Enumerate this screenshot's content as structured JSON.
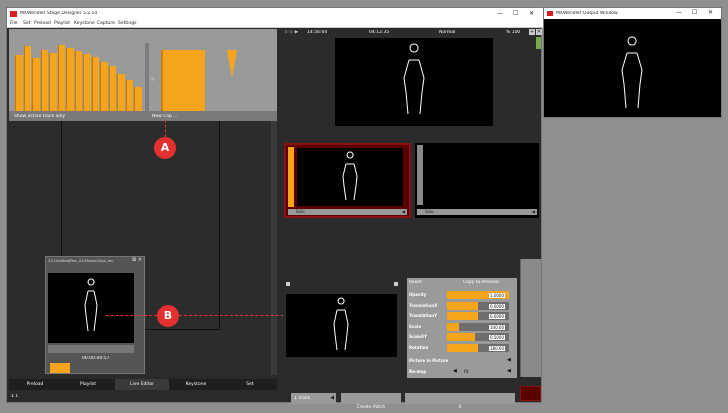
{
  "app": {
    "title": "MXWendler Stage Designer 5.2.14",
    "menu": [
      "File",
      "Set",
      "Preload",
      "Playlist",
      "Keystone",
      "Capture",
      "Settings"
    ]
  },
  "output_window": {
    "title": "MXWendler Output Window"
  },
  "clip_panel": {
    "show_active_label": "Show active track only",
    "new_clip_label": "New Clip ..."
  },
  "preview_header": {
    "time_left": "14:56:04",
    "time_mid": "04:12:35",
    "mode": "Normal",
    "percent": "% 100"
  },
  "decks": [
    {
      "label": "Solo"
    },
    {
      "label": "Solo"
    }
  ],
  "thumb_window": {
    "title": "23 Untitled/Rec_01/MovieClips_mc",
    "time": "00:00:00:57"
  },
  "fx_panel": {
    "reset_label": "Reset",
    "copy_label": "Copy to Preload",
    "sliders": [
      {
        "label": "Opacity",
        "value": "1.0000",
        "fill": 1.0
      },
      {
        "label": "TranslationX",
        "value": "0.0000",
        "fill": 0.5
      },
      {
        "label": "TranslationY",
        "value": "0.0000",
        "fill": 0.5
      },
      {
        "label": "Scale",
        "value": "100.00",
        "fill": 0.2
      },
      {
        "label": "ScaleXY",
        "value": "0.5000",
        "fill": 0.45
      },
      {
        "label": "Rotation",
        "value": "180.00",
        "fill": 0.5
      }
    ],
    "pip_label": "Picture In Picture",
    "remap_label": "Re-map",
    "remap_value": "Fit"
  },
  "bottom_row": {
    "track_label": "1 Track",
    "create_patch_label": "Create Patch",
    "x_label": "X"
  },
  "tabs": [
    "Preload",
    "Playlist",
    "Live Editor",
    "Keystone",
    "Set"
  ],
  "markers": [
    "A",
    "B"
  ],
  "bar_levels": [
    0.82,
    0.95,
    0.78,
    0.9,
    0.86,
    0.97,
    0.92,
    0.88,
    0.84,
    0.8,
    0.72,
    0.66,
    0.55,
    0.45,
    0.36
  ],
  "status_text": "1 1"
}
